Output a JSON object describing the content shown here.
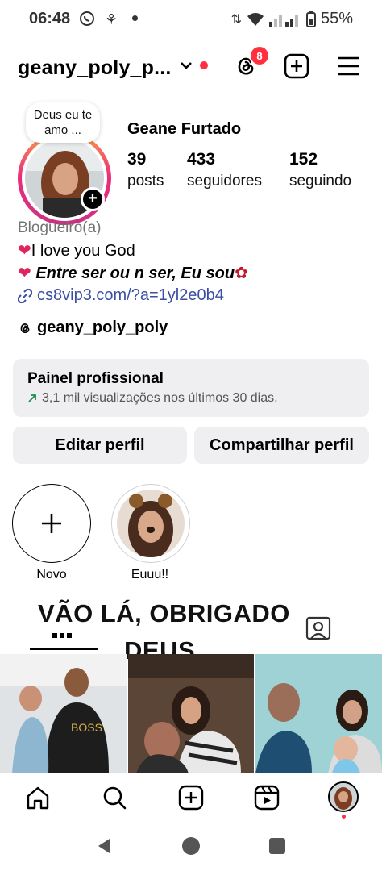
{
  "status_bar": {
    "time": "06:48",
    "battery": "55%"
  },
  "header": {
    "username": "geany_poly_p...",
    "notification_count": "8"
  },
  "profile": {
    "note": "Deus eu te amo ...",
    "full_name": "Geane Furtado",
    "stats": [
      {
        "value": "39",
        "label": "posts"
      },
      {
        "value": "433",
        "label": "seguidores"
      },
      {
        "value": "152",
        "label": "seguindo"
      }
    ],
    "category": "Blogueiro(a)",
    "bio_line1": "I love you God",
    "bio_line2_bold": "Entre ser ou n ser",
    "bio_line2_rest": ", Eu sou",
    "link": "cs8vip3.com/?a=1yl2e0b4",
    "threads_handle": "geany_poly_poly"
  },
  "pro_panel": {
    "title": "Painel profissional",
    "subtitle": "3,1 mil visualizações nos últimos 30 dias."
  },
  "buttons": {
    "edit": "Editar perfil",
    "share": "Compartilhar perfil"
  },
  "highlights": [
    {
      "label": "Novo"
    },
    {
      "label": "Euuu!!"
    }
  ],
  "overlay": {
    "line1": "VÃO LÁ, OBRIGADO",
    "line2": "DEUS"
  },
  "colors": {
    "accent_badge": "#ff3040",
    "link": "#3a4fa3",
    "panel_bg": "#efeff2"
  }
}
